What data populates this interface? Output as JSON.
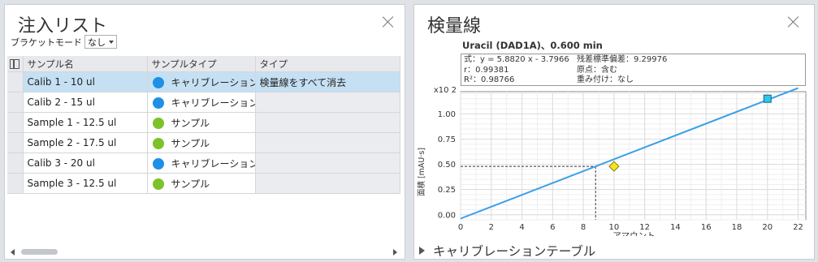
{
  "injection_panel": {
    "title": "注入リスト",
    "bracket_mode_label": "ブラケットモード",
    "bracket_mode_value": "なし",
    "columns": [
      "サンプル名",
      "サンプルタイプ",
      "タイプ"
    ],
    "rows": [
      {
        "name": "Calib 1 - 10 ul",
        "sample_type": "キャリブレーション",
        "type": "検量線をすべて消去",
        "color": "#1e90e8",
        "selected": true
      },
      {
        "name": "Calib 2 - 15 ul",
        "sample_type": "キャリブレーション",
        "type": "",
        "color": "#1e90e8",
        "selected": false
      },
      {
        "name": "Sample 1 - 12.5 ul",
        "sample_type": "サンプル",
        "type": "",
        "color": "#7dc22a",
        "selected": false
      },
      {
        "name": "Sample 2 - 17.5 ul",
        "sample_type": "サンプル",
        "type": "",
        "color": "#7dc22a",
        "selected": false
      },
      {
        "name": "Calib 3 - 20 ul",
        "sample_type": "キャリブレーション",
        "type": "",
        "color": "#1e90e8",
        "selected": false
      },
      {
        "name": "Sample 3 - 12.5 ul",
        "sample_type": "サンプル",
        "type": "",
        "color": "#7dc22a",
        "selected": false
      }
    ]
  },
  "calibration_panel": {
    "title": "検量線",
    "chart_title": "Uracil (DAD1A)、0.600 min",
    "info": {
      "equation": "式：y = 5.8820 x - 3.7966",
      "r": "r：0.99381",
      "r2": "R²：0.98766",
      "residual_std": "残差標準偏差：9.29976",
      "origin": "原点：含む",
      "weighting": "重み付け：なし"
    },
    "expander_label": "キャリブレーションテーブル"
  },
  "chart_data": {
    "type": "scatter",
    "xlabel": "アマウント",
    "ylabel": "面積 [mAU·s]",
    "y_multiplier": "x10 2",
    "xlim": [
      0,
      22.5
    ],
    "ylim": [
      -0.05,
      1.22
    ],
    "x_ticks": [
      0,
      2,
      4,
      6,
      8,
      10,
      12,
      14,
      16,
      18,
      20,
      22
    ],
    "y_ticks": [
      0.0,
      0.25,
      0.5,
      0.75,
      1.0
    ],
    "grid": true,
    "fit_line": {
      "slope": 5.882,
      "intercept": -3.7966,
      "x_range": [
        0,
        22
      ]
    },
    "series": [
      {
        "values": [
          {
            "x": 20,
            "y": 1.15
          }
        ],
        "marker": "square",
        "color": "#2ec7ea"
      },
      {
        "values": [
          {
            "x": 10,
            "y": 0.48
          }
        ],
        "marker": "diamond",
        "color": "#f5e322"
      }
    ],
    "crosshair": {
      "x": 8.8,
      "y": 0.48
    }
  },
  "colors": {
    "selection": "#c6e0f3",
    "calibration_dot": "#1e90e8",
    "sample_dot": "#7dc22a",
    "fit_line": "#3aa0e8"
  }
}
